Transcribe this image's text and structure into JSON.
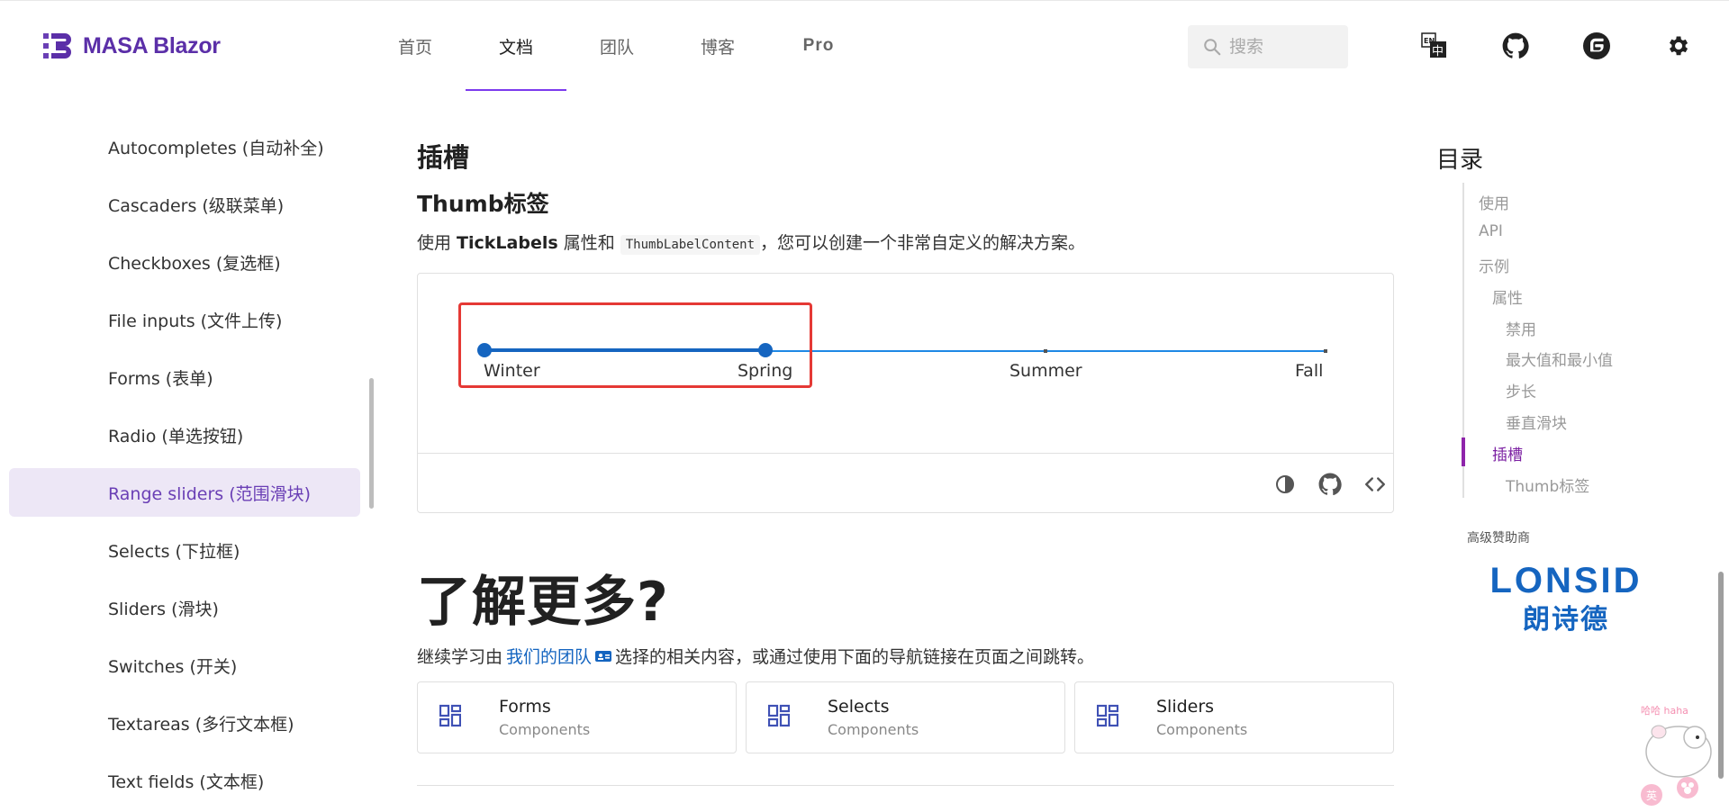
{
  "header": {
    "logo_text": "MASA Blazor",
    "nav": [
      "首页",
      "文档",
      "团队",
      "博客",
      "Pro"
    ],
    "active_nav": "文档",
    "search_placeholder": "搜索",
    "icons": [
      "language-switch-icon",
      "github-icon",
      "gitee-icon",
      "settings-icon"
    ],
    "brand_color": "#5b2fa8"
  },
  "sidebar": {
    "items": [
      "Autocompletes (自动补全)",
      "Cascaders (级联菜单)",
      "Checkboxes (复选框)",
      "File inputs (文件上传)",
      "Forms (表单)",
      "Radio (单选按钮)",
      "Range sliders (范围滑块)",
      "Selects (下拉框)",
      "Sliders (滑块)",
      "Switches (开关)",
      "Textareas (多行文本框)",
      "Text fields (文本框)"
    ],
    "active_item": "Range sliders (范围滑块)"
  },
  "main": {
    "section_title": "插槽",
    "subsection_title": "Thumb标签",
    "desc_prefix": "使用 ",
    "desc_bold": "TickLabels",
    "desc_mid": " 属性和 ",
    "desc_code": "ThumbLabelContent",
    "desc_suffix": "，您可以创建一个非常自定义的解决方案。",
    "slider": {
      "tick_labels": [
        "Winter",
        "Spring",
        "Summer",
        "Fall"
      ],
      "range": [
        0,
        1
      ],
      "accent_color": "#1565c0"
    },
    "demo_toolbar_icons": [
      "invert-colors-icon",
      "github-icon",
      "code-icon"
    ],
    "learn_more_title": "了解更多?",
    "learn_more_prefix": "继续学习由",
    "learn_more_link": "我们的团队",
    "learn_more_suffix": "选择的相关内容，或通过使用下面的导航链接在页面之间跳转。",
    "cards": [
      {
        "title": "Forms",
        "subtitle": "Components"
      },
      {
        "title": "Selects",
        "subtitle": "Components"
      },
      {
        "title": "Sliders",
        "subtitle": "Components"
      }
    ]
  },
  "toc": {
    "title": "目录",
    "items": [
      "使用",
      "API",
      "示例",
      "属性",
      "禁用",
      "最大值和最小值",
      "步长",
      "垂直滑块",
      "插槽",
      "Thumb标签"
    ],
    "active_item": "插槽"
  },
  "sponsor": {
    "label": "高级赞助商",
    "logo_text": "LONSID",
    "logo_sub": "朗诗德"
  },
  "mascot": {
    "text": "哈哈 haha",
    "badge_left": "英",
    "badge_right": "🐭"
  }
}
